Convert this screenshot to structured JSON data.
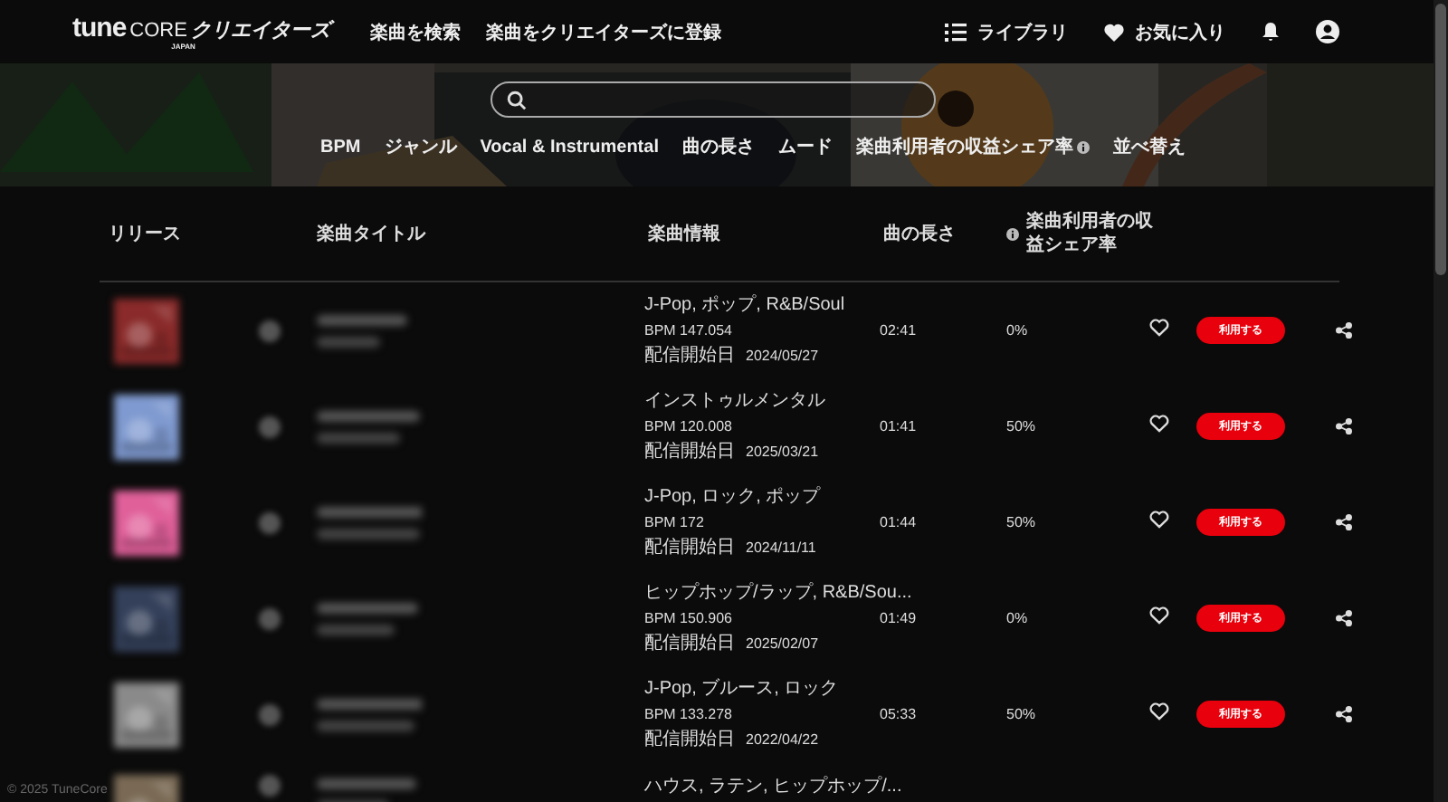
{
  "header": {
    "logo": {
      "brand": "tune",
      "brand_suffix": "CORE",
      "name": "クリエイターズ",
      "sub": "JAPAN"
    },
    "nav": [
      "楽曲を検索",
      "楽曲をクリエイターズに登録"
    ],
    "actions": [
      {
        "kind": "library",
        "label": "ライブラリ"
      },
      {
        "kind": "favorites",
        "label": "お気に入り"
      },
      {
        "kind": "bell"
      },
      {
        "kind": "account"
      }
    ]
  },
  "hero": {
    "kind": "picture",
    "filters": [
      {
        "label": "BPM",
        "help": false
      },
      {
        "label": "ジャンル",
        "help": false
      },
      {
        "label": "Vocal & Instrumental",
        "help": false
      },
      {
        "label": "曲の長さ",
        "help": false
      },
      {
        "label": "ムード",
        "help": false
      },
      {
        "label": "楽曲利用者の収益シェア率",
        "help": true
      },
      {
        "label": "並べ替え",
        "help": false
      }
    ]
  },
  "table": {
    "columns": [
      {
        "label": "リリース",
        "help": false
      },
      {
        "label": "楽曲タイトル",
        "help": false
      },
      {
        "label": "楽曲情報",
        "help": false
      },
      {
        "label": "曲の長さ",
        "help": false
      },
      {
        "label": "楽曲利用者の収益シェア率",
        "help": true
      }
    ],
    "rows": [
      {
        "color": "#8a2a2a",
        "genre": "J-Pop, ポップ, R&B/Soul",
        "bpm": "BPM 147.054",
        "date_label": "配信開始日",
        "date": "2024/05/27",
        "length": "02:41",
        "share": "0%",
        "favorite": false,
        "button": "利用する"
      },
      {
        "color": "#7f9ad0",
        "genre": "インストゥルメンタル",
        "bpm": "BPM 120.008",
        "date_label": "配信開始日",
        "date": "2025/03/21",
        "length": "01:41",
        "share": "50%",
        "favorite": false,
        "button": "利用する"
      },
      {
        "color": "#e0609a",
        "genre": "J-Pop, ロック, ポップ",
        "bpm": "BPM 172",
        "date_label": "配信開始日",
        "date": "2024/11/11",
        "length": "01:44",
        "share": "50%",
        "favorite": false,
        "button": "利用する"
      },
      {
        "color": "#34405a",
        "genre": "ヒップホップ/ラップ, R&B/Sou...",
        "bpm": "BPM 150.906",
        "date_label": "配信開始日",
        "date": "2025/02/07",
        "length": "01:49",
        "share": "0%",
        "favorite": false,
        "button": "利用する"
      },
      {
        "color": "#8a8a8a",
        "genre": "J-Pop, ブルース, ロック",
        "bpm": "BPM 133.278",
        "date_label": "配信開始日",
        "date": "2022/04/22",
        "length": "05:33",
        "share": "50%",
        "favorite": false,
        "button": "利用する"
      },
      {
        "color": "#7a6a55",
        "genre": "ハウス, ラテン, ヒップホップ/..."
      }
    ]
  },
  "footer": {
    "copyright": "© 2025 TuneCore"
  }
}
